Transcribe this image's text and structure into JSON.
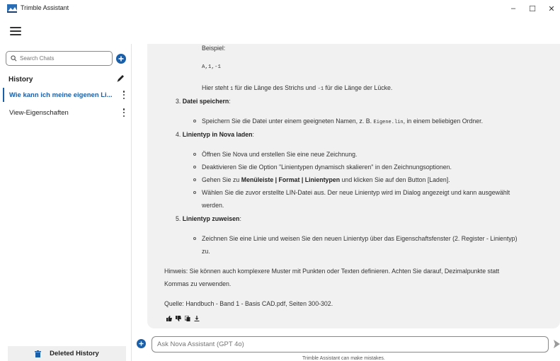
{
  "window": {
    "title": "Trimble Assistant",
    "minimize_label": "–",
    "maximize_label": "☐",
    "close_label": "✕"
  },
  "sidebar": {
    "search_placeholder": "Search Chats",
    "history_label": "History",
    "items": [
      {
        "label": "Wie kann ich meine eigenen Li...",
        "active": true
      },
      {
        "label": "View-Eigenschaften",
        "active": false
      }
    ],
    "deleted_history_label": "Deleted History"
  },
  "chat": {
    "lines": {
      "beispiel": "Beispiel:",
      "code_example": "A,1,-1",
      "hier_a": "Hier steht ",
      "hier_code1": "1",
      "hier_b": " für die Länge des Strichs und ",
      "hier_code2": "-1",
      "hier_c": " für die Länge der Lücke.",
      "step3_num": "3. ",
      "step3_title": "Datei speichern",
      "step3_colon": ":",
      "step3_b1_a": "Speichern Sie die Datei unter einem geeigneten Namen, z. B. ",
      "step3_b1_code": "Eigene.lin",
      "step3_b1_b": ", in einem beliebigen Ordner.",
      "step4_num": "4. ",
      "step4_title": "Linientyp in Nova laden",
      "step4_colon": ":",
      "step4_b1": "Öffnen Sie Nova und erstellen Sie eine neue Zeichnung.",
      "step4_b2": "Deaktivieren Sie die Option \"Linientypen dynamisch skalieren\" in den Zeichnungsoptionen.",
      "step4_b3_a": "Gehen Sie zu ",
      "step4_b3_bold": "Menüleiste | Format | Linientypen",
      "step4_b3_b": " und klicken Sie auf den Button [Laden].",
      "step4_b4_l1": "Wählen Sie die zuvor erstellte LIN-Datei aus. Der neue Linientyp wird im Dialog angezeigt und kann ausgewählt",
      "step4_b4_l2": "werden.",
      "step5_num": "5. ",
      "step5_title": "Linientyp zuweisen",
      "step5_colon": ":",
      "step5_b1_l1": "Zeichnen Sie eine Linie und weisen Sie den neuen Linientyp über das Eigenschaftsfenster (2. Register - Linientyp)",
      "step5_b1_l2": "zu.",
      "hinweis_l1": "Hinweis: Sie können auch komplexere Muster mit Punkten oder Texten definieren. Achten Sie darauf, Dezimalpunkte statt",
      "hinweis_l2": "Kommas zu verwenden.",
      "quelle": "Quelle: Handbuch - Band 1 - Basis CAD.pdf, Seiten 300-302."
    },
    "input_placeholder": "Ask Nova Assistant (GPT 4o)",
    "disclaimer": "Trimble Assistant can make mistakes."
  },
  "colors": {
    "accent": "#1a5fa8",
    "panel_bg": "#f1f1f1"
  }
}
